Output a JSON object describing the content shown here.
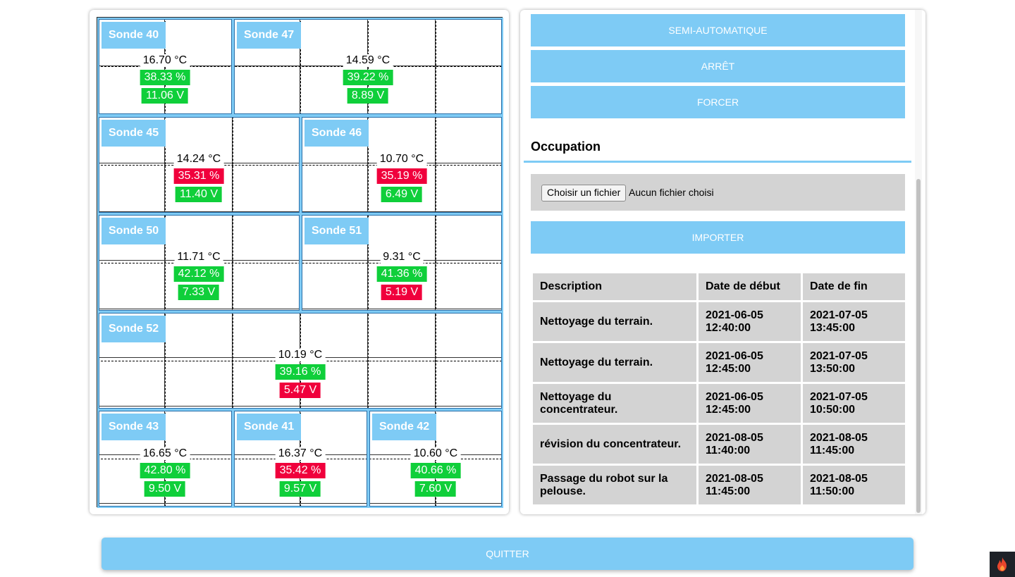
{
  "zones": [
    {
      "label": "Sonde 40",
      "temperature": "16.70 °C",
      "humidity": "38.33 %",
      "humidity_status": "ok",
      "voltage": "11.06 V",
      "voltage_status": "ok"
    },
    {
      "label": "Sonde 47",
      "temperature": "14.59 °C",
      "humidity": "39.22 %",
      "humidity_status": "ok",
      "voltage": "8.89 V",
      "voltage_status": "ok"
    },
    {
      "label": "Sonde 45",
      "temperature": "14.24 °C",
      "humidity": "35.31 %",
      "humidity_status": "bad",
      "voltage": "11.40 V",
      "voltage_status": "ok"
    },
    {
      "label": "Sonde 46",
      "temperature": "10.70 °C",
      "humidity": "35.19 %",
      "humidity_status": "bad",
      "voltage": "6.49 V",
      "voltage_status": "ok"
    },
    {
      "label": "Sonde 50",
      "temperature": "11.71 °C",
      "humidity": "42.12 %",
      "humidity_status": "ok",
      "voltage": "7.33 V",
      "voltage_status": "ok"
    },
    {
      "label": "Sonde 51",
      "temperature": "9.31 °C",
      "humidity": "41.36 %",
      "humidity_status": "ok",
      "voltage": "5.19 V",
      "voltage_status": "bad"
    },
    {
      "label": "Sonde 52",
      "temperature": "10.19 °C",
      "humidity": "39.16 %",
      "humidity_status": "ok",
      "voltage": "5.47 V",
      "voltage_status": "bad"
    },
    {
      "label": "Sonde 43",
      "temperature": "16.65 °C",
      "humidity": "42.80 %",
      "humidity_status": "ok",
      "voltage": "9.50 V",
      "voltage_status": "ok"
    },
    {
      "label": "Sonde 41",
      "temperature": "16.37 °C",
      "humidity": "35.42 %",
      "humidity_status": "bad",
      "voltage": "9.57 V",
      "voltage_status": "ok"
    },
    {
      "label": "Sonde 42",
      "temperature": "10.60 °C",
      "humidity": "40.66 %",
      "humidity_status": "ok",
      "voltage": "7.60 V",
      "voltage_status": "ok"
    }
  ],
  "controls": {
    "semi_auto_label": "SEMI-AUTOMATIQUE",
    "stop_label": "ARRÊT",
    "force_label": "FORCER"
  },
  "occupation": {
    "title": "Occupation",
    "file_button_label": "Choisir un fichier",
    "file_status": "Aucun fichier choisi",
    "import_label": "IMPORTER",
    "table": {
      "headers": [
        "Description",
        "Date de début",
        "Date de fin"
      ],
      "rows": [
        [
          "Nettoyage du terrain.",
          "2021-06-05 12:40:00",
          "2021-07-05 13:45:00"
        ],
        [
          "Nettoyage du terrain.",
          "2021-06-05 12:45:00",
          "2021-07-05 13:50:00"
        ],
        [
          "Nettoyage du concentrateur.",
          "2021-06-05 12:45:00",
          "2021-07-05 10:50:00"
        ],
        [
          "révision du concentrateur.",
          "2021-08-05 11:40:00",
          "2021-08-05 11:45:00"
        ],
        [
          "Passage du robot sur la pelouse.",
          "2021-08-05 11:45:00",
          "2021-08-05 11:50:00"
        ]
      ]
    }
  },
  "footer": {
    "quit_label": "QUITTER"
  },
  "colors": {
    "accent": "#7ecbf5",
    "ok": "#0fcf3a",
    "bad": "#f0003c",
    "cell_gray": "#d3d3d3"
  },
  "icons": {
    "corner_badge": "flame-icon"
  }
}
